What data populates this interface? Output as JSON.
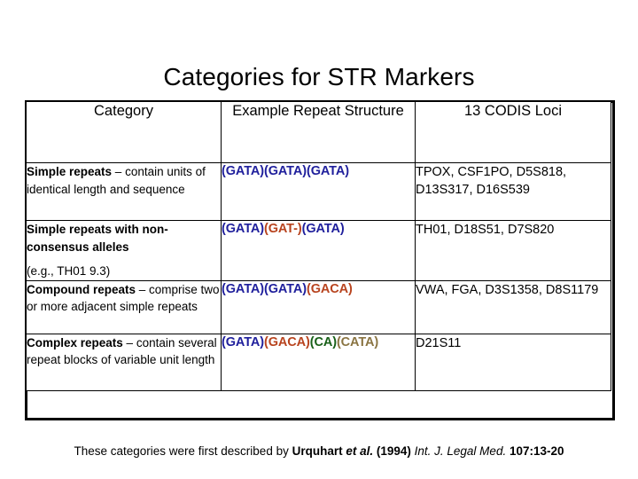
{
  "slide": {
    "title": "Categories for STR Markers",
    "footer": {
      "lead": "These categories were first described by ",
      "author": "Urquhart ",
      "author_italic": "et al.",
      "year": " (1994) ",
      "journal": "Int. J. Legal Med.",
      "citation": " 107:13-20"
    }
  },
  "table": {
    "headers": [
      "Category",
      "Example Repeat Structure",
      "13 CODIS Loci"
    ],
    "rows": [
      {
        "category_bold": "Simple repeats",
        "category_dash": " – ",
        "category_rest": "contain units of identical length and sequence",
        "category_sub": "",
        "repeat_segments": [
          {
            "text": "(GATA)",
            "color": "blue"
          },
          {
            "text": "(GATA)",
            "color": "blue"
          },
          {
            "text": "(GATA)",
            "color": "blue"
          }
        ],
        "loci": "TPOX, CSF1PO, D5S818, D13S317, D16S539"
      },
      {
        "category_bold": "Simple repeats with non-consensus alleles",
        "category_dash": "",
        "category_rest": "",
        "category_sub": "(e.g., TH01 9.3)",
        "repeat_segments": [
          {
            "text": "(GATA)",
            "color": "blue"
          },
          {
            "text": "(GAT-)",
            "color": "red"
          },
          {
            "text": "(GATA)",
            "color": "blue"
          }
        ],
        "loci": "TH01, D18S51, D7S820"
      },
      {
        "category_bold": "Compound repeats",
        "category_dash": " – ",
        "category_rest": "comprise two or more adjacent simple repeats",
        "category_sub": "",
        "repeat_segments": [
          {
            "text": "(GATA)",
            "color": "blue"
          },
          {
            "text": "(GATA)",
            "color": "blue"
          },
          {
            "text": "(GACA)",
            "color": "red"
          }
        ],
        "loci": "VWA, FGA, D3S1358, D8S1179"
      },
      {
        "category_bold": "Complex repeats",
        "category_dash": " – ",
        "category_rest": "contain several repeat blocks of variable unit length",
        "category_sub": "",
        "repeat_segments": [
          {
            "text": "(GATA)",
            "color": "blue"
          },
          {
            "text": "(GACA)",
            "color": "red"
          },
          {
            "text": "(CA)",
            "color": "green"
          },
          {
            "text": "(CATA)",
            "color": "tan"
          }
        ],
        "loci": "D21S11"
      }
    ]
  },
  "colors": {
    "blue": "#1f1f9c",
    "red": "#b8441f",
    "green": "#186018",
    "tan": "#8a7442",
    "background": "#ffffff",
    "text": "#000000",
    "border": "#000000"
  }
}
